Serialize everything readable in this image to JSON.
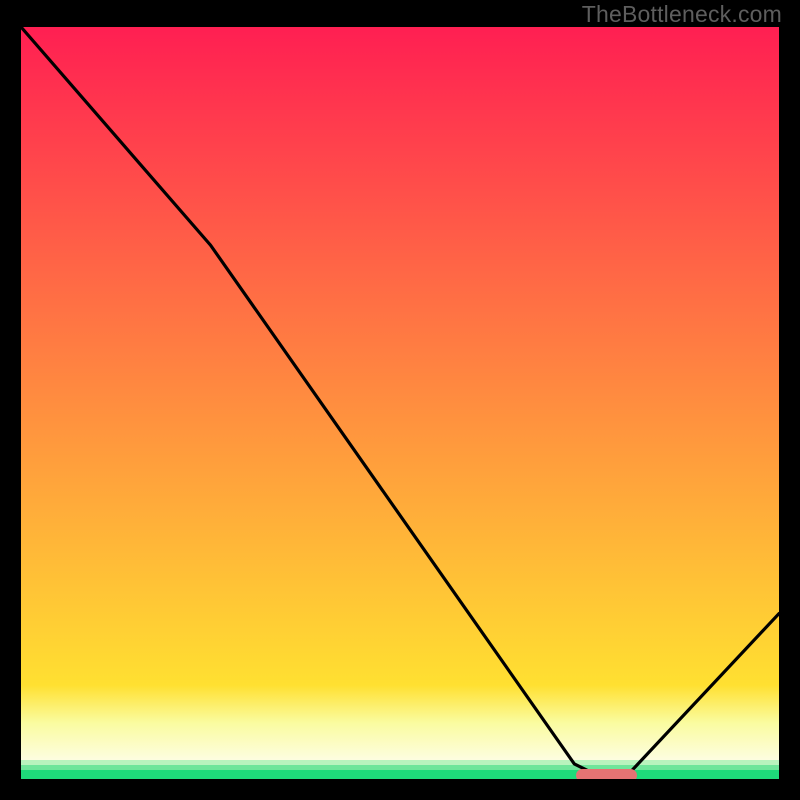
{
  "watermark": "TheBottleneck.com",
  "chart_data": {
    "type": "line",
    "title": "",
    "xlabel": "",
    "ylabel": "",
    "xlim": [
      0,
      100
    ],
    "ylim": [
      0,
      100
    ],
    "series": [
      {
        "name": "bottleneck-curve",
        "x": [
          0,
          25,
          73,
          76,
          80,
          100
        ],
        "values": [
          100,
          71,
          2,
          0.5,
          0.5,
          22
        ]
      }
    ],
    "marker": {
      "x_start": 73,
      "x_end": 81,
      "y": 0
    },
    "gradient_bands": [
      {
        "weight": 87.5,
        "from": "#ff1f52",
        "to": "#ffe031"
      },
      {
        "weight": 5.0,
        "from": "#ffe031",
        "to": "#fafca0"
      },
      {
        "weight": 5.0,
        "from": "#fafca0",
        "to": "#fdfde0"
      },
      {
        "weight": 0.7,
        "from": "#b9f3bd",
        "to": "#b9f3bd"
      },
      {
        "weight": 0.6,
        "from": "#6fe59a",
        "to": "#6fe59a"
      },
      {
        "weight": 1.2,
        "from": "#1edb7a",
        "to": "#1edb7a"
      }
    ]
  }
}
